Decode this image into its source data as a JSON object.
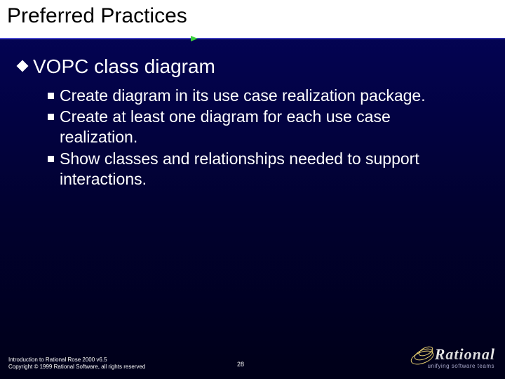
{
  "title": "Preferred Practices",
  "bullets": {
    "l1": "VOPC class diagram",
    "l2": [
      "Create diagram in its use case realization package.",
      "Create at least one diagram for each use case realization.",
      "Show classes and relationships needed to support interactions."
    ]
  },
  "footer": {
    "line1": "Introduction to Rational Rose 2000 v6.5",
    "line2": "Copyright © 1999 Rational Software, all rights reserved",
    "page": "28",
    "brand": "Rational",
    "tagline": "unifying software teams"
  }
}
